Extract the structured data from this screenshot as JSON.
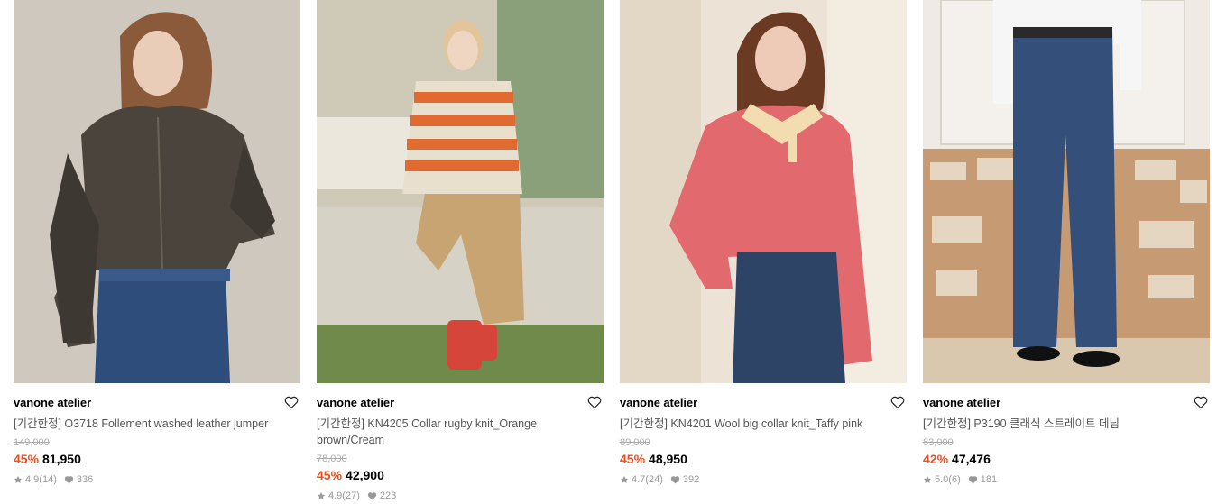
{
  "products": [
    {
      "brand": "vanone atelier",
      "name": "[기간한정] O3718 Follement washed leather jumper",
      "original_price": "149,000",
      "discount": "45%",
      "price": "81,950",
      "rating": "4.9",
      "reviews": "(14)",
      "likes": "336",
      "image_icon": "model-leather-jumper-photo"
    },
    {
      "brand": "vanone atelier",
      "name": "[기간한정] KN4205 Collar rugby knit_Orange brown/Cream",
      "original_price": "78,000",
      "discount": "45%",
      "price": "42,900",
      "rating": "4.9",
      "reviews": "(27)",
      "likes": "223",
      "image_icon": "model-rugby-knit-photo"
    },
    {
      "brand": "vanone atelier",
      "name": "[기간한정] KN4201 Wool big collar knit_Taffy pink",
      "original_price": "89,000",
      "discount": "45%",
      "price": "48,950",
      "rating": "4.7",
      "reviews": "(24)",
      "likes": "392",
      "image_icon": "model-pink-knit-photo"
    },
    {
      "brand": "vanone atelier",
      "name": "[기간한정] P3190 클래식 스트레이트 데님",
      "original_price": "83,000",
      "discount": "42%",
      "price": "47,476",
      "rating": "5.0",
      "reviews": "(6)",
      "likes": "181",
      "image_icon": "model-straight-denim-photo"
    }
  ],
  "colors": {
    "discount": "#f04c1c",
    "muted": "#999999",
    "strike": "#aaaaaa"
  }
}
